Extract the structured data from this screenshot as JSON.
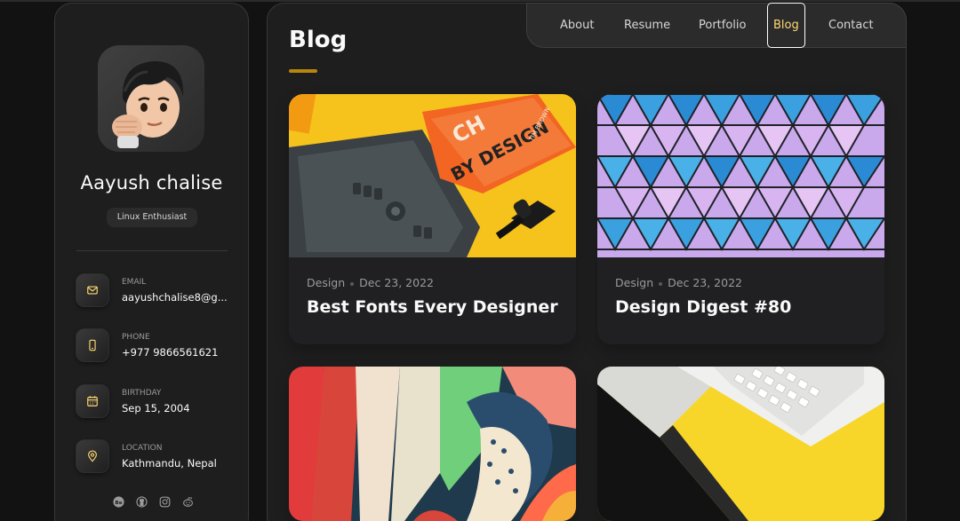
{
  "profile": {
    "name": "Aayush chalise",
    "title": "Linux Enthusiast"
  },
  "contacts": [
    {
      "label": "EMAIL",
      "value": "aayushchalise8@g...",
      "icon": "mail-icon"
    },
    {
      "label": "PHONE",
      "value": "+977 9866561621",
      "icon": "phone-icon"
    },
    {
      "label": "BIRTHDAY",
      "value": "Sep 15, 2004",
      "icon": "calendar-icon"
    },
    {
      "label": "LOCATION",
      "value": "Kathmandu, Nepal",
      "icon": "location-pin-icon"
    }
  ],
  "socials": [
    "behance-icon",
    "github-icon",
    "instagram-icon",
    "reddit-icon"
  ],
  "nav": {
    "items": [
      "About",
      "Resume",
      "Portfolio",
      "Blog",
      "Contact"
    ],
    "active": "Blog"
  },
  "page": {
    "title": "Blog"
  },
  "posts": [
    {
      "category": "Design",
      "date": "Dec 23, 2022",
      "title": "Best Fonts Every Designer"
    },
    {
      "category": "Design",
      "date": "Dec 23, 2022",
      "title": "Design Digest #80"
    },
    {
      "category": "",
      "date": "",
      "title": ""
    },
    {
      "category": "",
      "date": "",
      "title": ""
    }
  ],
  "colors": {
    "accent": "#ffdb70",
    "background": "#121212",
    "panel": "#1e1e1f",
    "text": "#fafafa"
  }
}
